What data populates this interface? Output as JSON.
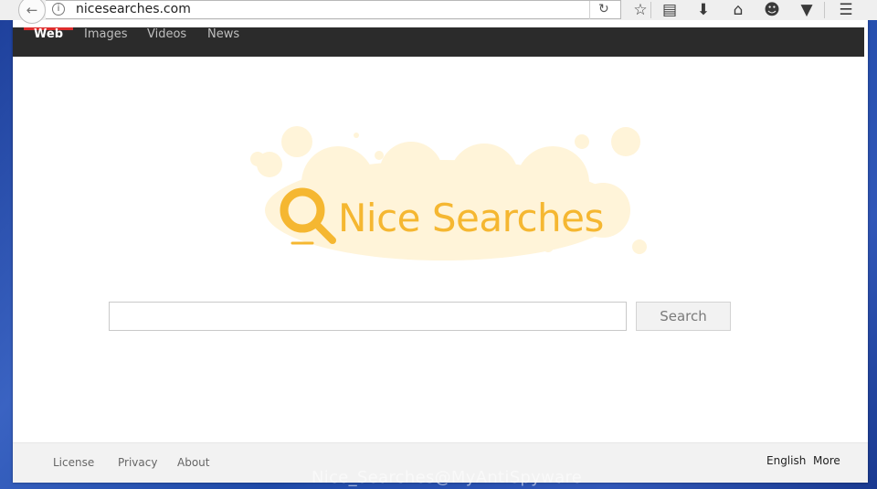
{
  "browser": {
    "url": "nicesearches.com",
    "back_icon": "back-arrow-icon",
    "info_icon": "info-icon",
    "reload_icon": "reload-icon",
    "toolbar_icons": [
      "star-icon",
      "reading-list-icon",
      "download-icon",
      "home-icon",
      "chat-icon",
      "pocket-icon",
      "menu-icon"
    ]
  },
  "site_nav": {
    "tabs": [
      {
        "label": "Web",
        "active": true
      },
      {
        "label": "Images",
        "active": false
      },
      {
        "label": "Videos",
        "active": false
      },
      {
        "label": "News",
        "active": false
      }
    ]
  },
  "logo": {
    "text": "Nice Searches",
    "color": "#f5b731"
  },
  "search": {
    "value": "",
    "button_label": "Search"
  },
  "footer": {
    "left_links": [
      "License",
      "Privacy",
      "About"
    ],
    "right_links": [
      "English",
      "More"
    ]
  },
  "watermark": "Nice_Searches@MyAntiSpyware"
}
